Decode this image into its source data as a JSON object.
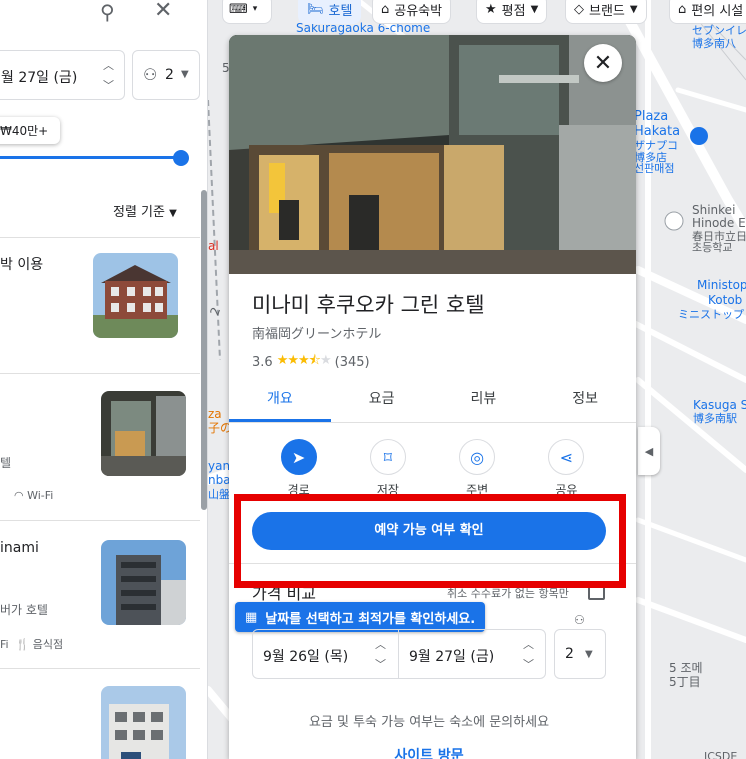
{
  "left_panel": {
    "date_value": "월 27일 (금)",
    "guests_value": "2",
    "price_bubble": "₩40만+",
    "sort_label": "정렬 기준",
    "results": [
      {
        "title": "박 이용",
        "subtitle": "",
        "amenities": []
      },
      {
        "title": "",
        "subtitle": "텔",
        "amenities": [
          "Wi-Fi"
        ]
      },
      {
        "title": "inami",
        "subtitle": "버가 호텔",
        "amenities": [
          "Fi",
          "음식점"
        ]
      },
      {
        "title": "",
        "subtitle": "",
        "amenities": []
      }
    ]
  },
  "filters": {
    "hotel": "호텔",
    "shared": "공유숙박",
    "rating": "평점",
    "brand": "브랜드",
    "amenities": "편의 시설"
  },
  "map_labels": {
    "sakuragaoka": "Sakuragaoka 6-chome",
    "plaza": "Plaza",
    "hakata": "Hakata",
    "plaza_jp1": "ザナプコ",
    "plaza_jp2": "博多店",
    "plaza_jp3": "선판매점",
    "hinode_en": "Shinkei",
    "hinode_en2": "Hinode E",
    "hinode_jp": "春日市立日",
    "hinode_kr": "초등학교",
    "ministop": "Ministop",
    "kotobu": "Kotob",
    "ministop_jp": "ミニストップ",
    "kasuga": "Kasuga Stat",
    "kasuga_jp": "博多南駅",
    "seven1": "セブンイレ",
    "seven2": "博多南八",
    "chome_kr": "5 조메",
    "chome_jp": "5丁目",
    "icsde": "ICSDE",
    "side_a": "za",
    "side_b": "子の",
    "side_c": "yan",
    "side_d": "nba",
    "side_e": "山盤",
    "side_f": "al",
    "side_g": "5",
    "side_h": "2"
  },
  "hotel": {
    "name": "미나미 후쿠오카 그린 호텔",
    "name_jp": "南福岡グリーンホテル",
    "rating": "3.6",
    "stars": 3.6,
    "reviews": "(345)",
    "tabs": [
      "개요",
      "요금",
      "리뷰",
      "정보"
    ],
    "actions": [
      "경로",
      "저장",
      "주변",
      "공유"
    ],
    "book_label": "예약 가능 여부 확인",
    "price_compare": "가격 비교",
    "free_cancel": "취소 수수료가 없는 항목만",
    "date_tooltip": "날짜를 선택하고 최적가를 확인하세요.",
    "checkin": "9월 26일 (목)",
    "checkout": "9월 27일 (금)",
    "guests": "2",
    "inquiry_note": "요금 및 투숙 가능 여부는 숙소에 문의하세요",
    "site_visit": "사이트 방문"
  },
  "colors": {
    "accent": "#1a73e8",
    "highlight": "#e60000",
    "star": "#fbbc04"
  }
}
